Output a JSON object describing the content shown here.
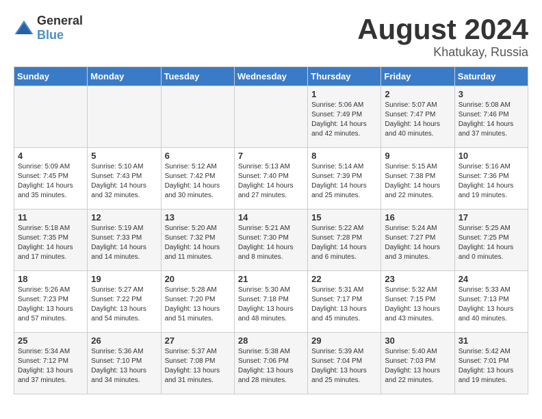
{
  "header": {
    "logo_general": "General",
    "logo_blue": "Blue",
    "month": "August 2024",
    "location": "Khatukay, Russia"
  },
  "days_of_week": [
    "Sunday",
    "Monday",
    "Tuesday",
    "Wednesday",
    "Thursday",
    "Friday",
    "Saturday"
  ],
  "weeks": [
    [
      {
        "day": "",
        "detail": ""
      },
      {
        "day": "",
        "detail": ""
      },
      {
        "day": "",
        "detail": ""
      },
      {
        "day": "",
        "detail": ""
      },
      {
        "day": "1",
        "detail": "Sunrise: 5:06 AM\nSunset: 7:49 PM\nDaylight: 14 hours\nand 42 minutes."
      },
      {
        "day": "2",
        "detail": "Sunrise: 5:07 AM\nSunset: 7:47 PM\nDaylight: 14 hours\nand 40 minutes."
      },
      {
        "day": "3",
        "detail": "Sunrise: 5:08 AM\nSunset: 7:46 PM\nDaylight: 14 hours\nand 37 minutes."
      }
    ],
    [
      {
        "day": "4",
        "detail": "Sunrise: 5:09 AM\nSunset: 7:45 PM\nDaylight: 14 hours\nand 35 minutes."
      },
      {
        "day": "5",
        "detail": "Sunrise: 5:10 AM\nSunset: 7:43 PM\nDaylight: 14 hours\nand 32 minutes."
      },
      {
        "day": "6",
        "detail": "Sunrise: 5:12 AM\nSunset: 7:42 PM\nDaylight: 14 hours\nand 30 minutes."
      },
      {
        "day": "7",
        "detail": "Sunrise: 5:13 AM\nSunset: 7:40 PM\nDaylight: 14 hours\nand 27 minutes."
      },
      {
        "day": "8",
        "detail": "Sunrise: 5:14 AM\nSunset: 7:39 PM\nDaylight: 14 hours\nand 25 minutes."
      },
      {
        "day": "9",
        "detail": "Sunrise: 5:15 AM\nSunset: 7:38 PM\nDaylight: 14 hours\nand 22 minutes."
      },
      {
        "day": "10",
        "detail": "Sunrise: 5:16 AM\nSunset: 7:36 PM\nDaylight: 14 hours\nand 19 minutes."
      }
    ],
    [
      {
        "day": "11",
        "detail": "Sunrise: 5:18 AM\nSunset: 7:35 PM\nDaylight: 14 hours\nand 17 minutes."
      },
      {
        "day": "12",
        "detail": "Sunrise: 5:19 AM\nSunset: 7:33 PM\nDaylight: 14 hours\nand 14 minutes."
      },
      {
        "day": "13",
        "detail": "Sunrise: 5:20 AM\nSunset: 7:32 PM\nDaylight: 14 hours\nand 11 minutes."
      },
      {
        "day": "14",
        "detail": "Sunrise: 5:21 AM\nSunset: 7:30 PM\nDaylight: 14 hours\nand 8 minutes."
      },
      {
        "day": "15",
        "detail": "Sunrise: 5:22 AM\nSunset: 7:28 PM\nDaylight: 14 hours\nand 6 minutes."
      },
      {
        "day": "16",
        "detail": "Sunrise: 5:24 AM\nSunset: 7:27 PM\nDaylight: 14 hours\nand 3 minutes."
      },
      {
        "day": "17",
        "detail": "Sunrise: 5:25 AM\nSunset: 7:25 PM\nDaylight: 14 hours\nand 0 minutes."
      }
    ],
    [
      {
        "day": "18",
        "detail": "Sunrise: 5:26 AM\nSunset: 7:23 PM\nDaylight: 13 hours\nand 57 minutes."
      },
      {
        "day": "19",
        "detail": "Sunrise: 5:27 AM\nSunset: 7:22 PM\nDaylight: 13 hours\nand 54 minutes."
      },
      {
        "day": "20",
        "detail": "Sunrise: 5:28 AM\nSunset: 7:20 PM\nDaylight: 13 hours\nand 51 minutes."
      },
      {
        "day": "21",
        "detail": "Sunrise: 5:30 AM\nSunset: 7:18 PM\nDaylight: 13 hours\nand 48 minutes."
      },
      {
        "day": "22",
        "detail": "Sunrise: 5:31 AM\nSunset: 7:17 PM\nDaylight: 13 hours\nand 45 minutes."
      },
      {
        "day": "23",
        "detail": "Sunrise: 5:32 AM\nSunset: 7:15 PM\nDaylight: 13 hours\nand 43 minutes."
      },
      {
        "day": "24",
        "detail": "Sunrise: 5:33 AM\nSunset: 7:13 PM\nDaylight: 13 hours\nand 40 minutes."
      }
    ],
    [
      {
        "day": "25",
        "detail": "Sunrise: 5:34 AM\nSunset: 7:12 PM\nDaylight: 13 hours\nand 37 minutes."
      },
      {
        "day": "26",
        "detail": "Sunrise: 5:36 AM\nSunset: 7:10 PM\nDaylight: 13 hours\nand 34 minutes."
      },
      {
        "day": "27",
        "detail": "Sunrise: 5:37 AM\nSunset: 7:08 PM\nDaylight: 13 hours\nand 31 minutes."
      },
      {
        "day": "28",
        "detail": "Sunrise: 5:38 AM\nSunset: 7:06 PM\nDaylight: 13 hours\nand 28 minutes."
      },
      {
        "day": "29",
        "detail": "Sunrise: 5:39 AM\nSunset: 7:04 PM\nDaylight: 13 hours\nand 25 minutes."
      },
      {
        "day": "30",
        "detail": "Sunrise: 5:40 AM\nSunset: 7:03 PM\nDaylight: 13 hours\nand 22 minutes."
      },
      {
        "day": "31",
        "detail": "Sunrise: 5:42 AM\nSunset: 7:01 PM\nDaylight: 13 hours\nand 19 minutes."
      }
    ]
  ]
}
